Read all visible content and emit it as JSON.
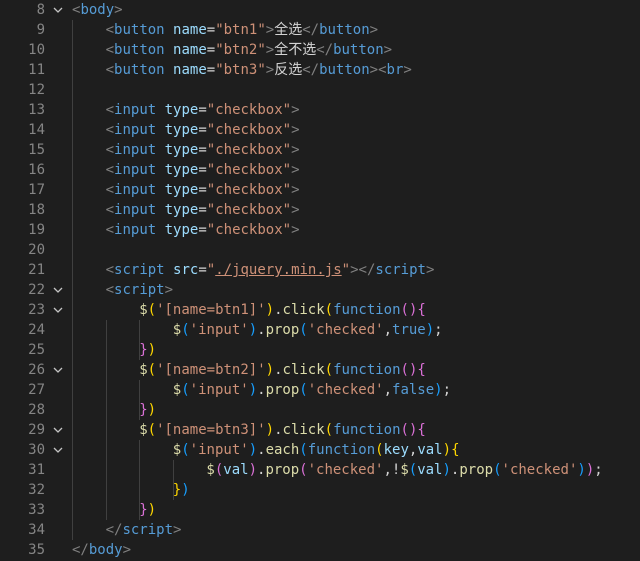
{
  "editor": {
    "lines": [
      {
        "num": "8",
        "fold": true,
        "indent": 0,
        "tokens": [
          {
            "t": "<",
            "c": "br"
          },
          {
            "t": "body",
            "c": "tg"
          },
          {
            "t": ">",
            "c": "br"
          }
        ]
      },
      {
        "num": "9",
        "fold": false,
        "indent": 1,
        "tokens": [
          {
            "t": "<",
            "c": "br"
          },
          {
            "t": "button",
            "c": "tg"
          },
          {
            "t": " ",
            "c": "tx"
          },
          {
            "t": "name",
            "c": "at"
          },
          {
            "t": "=",
            "c": "tx"
          },
          {
            "t": "\"btn1\"",
            "c": "st"
          },
          {
            "t": ">",
            "c": "br"
          },
          {
            "t": "全选",
            "c": "tx"
          },
          {
            "t": "</",
            "c": "br"
          },
          {
            "t": "button",
            "c": "tg"
          },
          {
            "t": ">",
            "c": "br"
          }
        ]
      },
      {
        "num": "10",
        "fold": false,
        "indent": 1,
        "tokens": [
          {
            "t": "<",
            "c": "br"
          },
          {
            "t": "button",
            "c": "tg"
          },
          {
            "t": " ",
            "c": "tx"
          },
          {
            "t": "name",
            "c": "at"
          },
          {
            "t": "=",
            "c": "tx"
          },
          {
            "t": "\"btn2\"",
            "c": "st"
          },
          {
            "t": ">",
            "c": "br"
          },
          {
            "t": "全不选",
            "c": "tx"
          },
          {
            "t": "</",
            "c": "br"
          },
          {
            "t": "button",
            "c": "tg"
          },
          {
            "t": ">",
            "c": "br"
          }
        ]
      },
      {
        "num": "11",
        "fold": false,
        "indent": 1,
        "tokens": [
          {
            "t": "<",
            "c": "br"
          },
          {
            "t": "button",
            "c": "tg"
          },
          {
            "t": " ",
            "c": "tx"
          },
          {
            "t": "name",
            "c": "at"
          },
          {
            "t": "=",
            "c": "tx"
          },
          {
            "t": "\"btn3\"",
            "c": "st"
          },
          {
            "t": ">",
            "c": "br"
          },
          {
            "t": "反选",
            "c": "tx"
          },
          {
            "t": "</",
            "c": "br"
          },
          {
            "t": "button",
            "c": "tg"
          },
          {
            "t": ">",
            "c": "br"
          },
          {
            "t": "<",
            "c": "br"
          },
          {
            "t": "br",
            "c": "tg"
          },
          {
            "t": ">",
            "c": "br"
          }
        ]
      },
      {
        "num": "12",
        "fold": false,
        "indent": 0,
        "tokens": []
      },
      {
        "num": "13",
        "fold": false,
        "indent": 1,
        "tokens": [
          {
            "t": "<",
            "c": "br"
          },
          {
            "t": "input",
            "c": "tg"
          },
          {
            "t": " ",
            "c": "tx"
          },
          {
            "t": "type",
            "c": "at"
          },
          {
            "t": "=",
            "c": "tx"
          },
          {
            "t": "\"checkbox\"",
            "c": "st"
          },
          {
            "t": ">",
            "c": "br"
          }
        ]
      },
      {
        "num": "14",
        "fold": false,
        "indent": 1,
        "tokens": [
          {
            "t": "<",
            "c": "br"
          },
          {
            "t": "input",
            "c": "tg"
          },
          {
            "t": " ",
            "c": "tx"
          },
          {
            "t": "type",
            "c": "at"
          },
          {
            "t": "=",
            "c": "tx"
          },
          {
            "t": "\"checkbox\"",
            "c": "st"
          },
          {
            "t": ">",
            "c": "br"
          }
        ]
      },
      {
        "num": "15",
        "fold": false,
        "indent": 1,
        "tokens": [
          {
            "t": "<",
            "c": "br"
          },
          {
            "t": "input",
            "c": "tg"
          },
          {
            "t": " ",
            "c": "tx"
          },
          {
            "t": "type",
            "c": "at"
          },
          {
            "t": "=",
            "c": "tx"
          },
          {
            "t": "\"checkbox\"",
            "c": "st"
          },
          {
            "t": ">",
            "c": "br"
          }
        ]
      },
      {
        "num": "16",
        "fold": false,
        "indent": 1,
        "tokens": [
          {
            "t": "<",
            "c": "br"
          },
          {
            "t": "input",
            "c": "tg"
          },
          {
            "t": " ",
            "c": "tx"
          },
          {
            "t": "type",
            "c": "at"
          },
          {
            "t": "=",
            "c": "tx"
          },
          {
            "t": "\"checkbox\"",
            "c": "st"
          },
          {
            "t": ">",
            "c": "br"
          }
        ]
      },
      {
        "num": "17",
        "fold": false,
        "indent": 1,
        "tokens": [
          {
            "t": "<",
            "c": "br"
          },
          {
            "t": "input",
            "c": "tg"
          },
          {
            "t": " ",
            "c": "tx"
          },
          {
            "t": "type",
            "c": "at"
          },
          {
            "t": "=",
            "c": "tx"
          },
          {
            "t": "\"checkbox\"",
            "c": "st"
          },
          {
            "t": ">",
            "c": "br"
          }
        ]
      },
      {
        "num": "18",
        "fold": false,
        "indent": 1,
        "tokens": [
          {
            "t": "<",
            "c": "br"
          },
          {
            "t": "input",
            "c": "tg"
          },
          {
            "t": " ",
            "c": "tx"
          },
          {
            "t": "type",
            "c": "at"
          },
          {
            "t": "=",
            "c": "tx"
          },
          {
            "t": "\"checkbox\"",
            "c": "st"
          },
          {
            "t": ">",
            "c": "br"
          }
        ]
      },
      {
        "num": "19",
        "fold": false,
        "indent": 1,
        "tokens": [
          {
            "t": "<",
            "c": "br"
          },
          {
            "t": "input",
            "c": "tg"
          },
          {
            "t": " ",
            "c": "tx"
          },
          {
            "t": "type",
            "c": "at"
          },
          {
            "t": "=",
            "c": "tx"
          },
          {
            "t": "\"checkbox\"",
            "c": "st"
          },
          {
            "t": ">",
            "c": "br"
          }
        ]
      },
      {
        "num": "20",
        "fold": false,
        "indent": 0,
        "tokens": []
      },
      {
        "num": "21",
        "fold": false,
        "indent": 1,
        "tokens": [
          {
            "t": "<",
            "c": "br"
          },
          {
            "t": "script",
            "c": "tg"
          },
          {
            "t": " ",
            "c": "tx"
          },
          {
            "t": "src",
            "c": "at"
          },
          {
            "t": "=",
            "c": "tx"
          },
          {
            "t": "\"",
            "c": "st"
          },
          {
            "t": "./jquery.min.js",
            "c": "st ul"
          },
          {
            "t": "\"",
            "c": "st"
          },
          {
            "t": ">",
            "c": "br"
          },
          {
            "t": "</",
            "c": "br"
          },
          {
            "t": "script",
            "c": "tg"
          },
          {
            "t": ">",
            "c": "br"
          }
        ]
      },
      {
        "num": "22",
        "fold": true,
        "indent": 1,
        "tokens": [
          {
            "t": "<",
            "c": "br"
          },
          {
            "t": "script",
            "c": "tg"
          },
          {
            "t": ">",
            "c": "br"
          }
        ]
      },
      {
        "num": "23",
        "fold": true,
        "indent": 2,
        "tokens": [
          {
            "t": "$",
            "c": "fn"
          },
          {
            "t": "(",
            "c": "p1"
          },
          {
            "t": "'[name=btn1]'",
            "c": "st"
          },
          {
            "t": ")",
            "c": "p1"
          },
          {
            "t": ".",
            "c": "pu"
          },
          {
            "t": "click",
            "c": "fn"
          },
          {
            "t": "(",
            "c": "p1"
          },
          {
            "t": "function",
            "c": "kw"
          },
          {
            "t": "(",
            "c": "p2"
          },
          {
            "t": ")",
            "c": "p2"
          },
          {
            "t": "{",
            "c": "p2"
          }
        ]
      },
      {
        "num": "24",
        "fold": false,
        "indent": 3,
        "tokens": [
          {
            "t": "$",
            "c": "fn"
          },
          {
            "t": "(",
            "c": "p3"
          },
          {
            "t": "'input'",
            "c": "st"
          },
          {
            "t": ")",
            "c": "p3"
          },
          {
            "t": ".",
            "c": "pu"
          },
          {
            "t": "prop",
            "c": "fn"
          },
          {
            "t": "(",
            "c": "p3"
          },
          {
            "t": "'checked'",
            "c": "st"
          },
          {
            "t": ",",
            "c": "pu"
          },
          {
            "t": "true",
            "c": "kw"
          },
          {
            "t": ")",
            "c": "p3"
          },
          {
            "t": ";",
            "c": "pu"
          }
        ]
      },
      {
        "num": "25",
        "fold": false,
        "indent": 2,
        "tokens": [
          {
            "t": "}",
            "c": "p2"
          },
          {
            "t": ")",
            "c": "p1"
          }
        ]
      },
      {
        "num": "26",
        "fold": true,
        "indent": 2,
        "tokens": [
          {
            "t": "$",
            "c": "fn"
          },
          {
            "t": "(",
            "c": "p1"
          },
          {
            "t": "'[name=btn2]'",
            "c": "st"
          },
          {
            "t": ")",
            "c": "p1"
          },
          {
            "t": ".",
            "c": "pu"
          },
          {
            "t": "click",
            "c": "fn"
          },
          {
            "t": "(",
            "c": "p1"
          },
          {
            "t": "function",
            "c": "kw"
          },
          {
            "t": "(",
            "c": "p2"
          },
          {
            "t": ")",
            "c": "p2"
          },
          {
            "t": "{",
            "c": "p2"
          }
        ]
      },
      {
        "num": "27",
        "fold": false,
        "indent": 3,
        "tokens": [
          {
            "t": "$",
            "c": "fn"
          },
          {
            "t": "(",
            "c": "p3"
          },
          {
            "t": "'input'",
            "c": "st"
          },
          {
            "t": ")",
            "c": "p3"
          },
          {
            "t": ".",
            "c": "pu"
          },
          {
            "t": "prop",
            "c": "fn"
          },
          {
            "t": "(",
            "c": "p3"
          },
          {
            "t": "'checked'",
            "c": "st"
          },
          {
            "t": ",",
            "c": "pu"
          },
          {
            "t": "false",
            "c": "kw"
          },
          {
            "t": ")",
            "c": "p3"
          },
          {
            "t": ";",
            "c": "pu"
          }
        ]
      },
      {
        "num": "28",
        "fold": false,
        "indent": 2,
        "tokens": [
          {
            "t": "}",
            "c": "p2"
          },
          {
            "t": ")",
            "c": "p1"
          }
        ]
      },
      {
        "num": "29",
        "fold": true,
        "indent": 2,
        "tokens": [
          {
            "t": "$",
            "c": "fn"
          },
          {
            "t": "(",
            "c": "p1"
          },
          {
            "t": "'[name=btn3]'",
            "c": "st"
          },
          {
            "t": ")",
            "c": "p1"
          },
          {
            "t": ".",
            "c": "pu"
          },
          {
            "t": "click",
            "c": "fn"
          },
          {
            "t": "(",
            "c": "p1"
          },
          {
            "t": "function",
            "c": "kw"
          },
          {
            "t": "(",
            "c": "p2"
          },
          {
            "t": ")",
            "c": "p2"
          },
          {
            "t": "{",
            "c": "p2"
          }
        ]
      },
      {
        "num": "30",
        "fold": true,
        "indent": 3,
        "tokens": [
          {
            "t": "$",
            "c": "fn"
          },
          {
            "t": "(",
            "c": "p3"
          },
          {
            "t": "'input'",
            "c": "st"
          },
          {
            "t": ")",
            "c": "p3"
          },
          {
            "t": ".",
            "c": "pu"
          },
          {
            "t": "each",
            "c": "fn"
          },
          {
            "t": "(",
            "c": "p3"
          },
          {
            "t": "function",
            "c": "kw"
          },
          {
            "t": "(",
            "c": "p1"
          },
          {
            "t": "key",
            "c": "vr"
          },
          {
            "t": ",",
            "c": "pu"
          },
          {
            "t": "val",
            "c": "vr"
          },
          {
            "t": ")",
            "c": "p1"
          },
          {
            "t": "{",
            "c": "p1"
          }
        ]
      },
      {
        "num": "31",
        "fold": false,
        "indent": 4,
        "tokens": [
          {
            "t": "$",
            "c": "fn"
          },
          {
            "t": "(",
            "c": "p2"
          },
          {
            "t": "val",
            "c": "vr"
          },
          {
            "t": ")",
            "c": "p2"
          },
          {
            "t": ".",
            "c": "pu"
          },
          {
            "t": "prop",
            "c": "fn"
          },
          {
            "t": "(",
            "c": "p2"
          },
          {
            "t": "'checked'",
            "c": "st"
          },
          {
            "t": ",!",
            "c": "pu"
          },
          {
            "t": "$",
            "c": "fn"
          },
          {
            "t": "(",
            "c": "p3"
          },
          {
            "t": "val",
            "c": "vr"
          },
          {
            "t": ")",
            "c": "p3"
          },
          {
            "t": ".",
            "c": "pu"
          },
          {
            "t": "prop",
            "c": "fn"
          },
          {
            "t": "(",
            "c": "p3"
          },
          {
            "t": "'checked'",
            "c": "st"
          },
          {
            "t": ")",
            "c": "p3"
          },
          {
            "t": ")",
            "c": "p2"
          },
          {
            "t": ";",
            "c": "pu"
          }
        ]
      },
      {
        "num": "32",
        "fold": false,
        "indent": 3,
        "tokens": [
          {
            "t": "}",
            "c": "p1"
          },
          {
            "t": ")",
            "c": "p3"
          }
        ]
      },
      {
        "num": "33",
        "fold": false,
        "indent": 2,
        "tokens": [
          {
            "t": "}",
            "c": "p2"
          },
          {
            "t": ")",
            "c": "p1"
          }
        ]
      },
      {
        "num": "34",
        "fold": false,
        "indent": 1,
        "tokens": [
          {
            "t": "</",
            "c": "br"
          },
          {
            "t": "script",
            "c": "tg"
          },
          {
            "t": ">",
            "c": "br"
          }
        ]
      },
      {
        "num": "35",
        "fold": false,
        "indent": 0,
        "tokens": [
          {
            "t": "</",
            "c": "br"
          },
          {
            "t": "body",
            "c": "tg"
          },
          {
            "t": ">",
            "c": "br"
          }
        ]
      }
    ]
  }
}
